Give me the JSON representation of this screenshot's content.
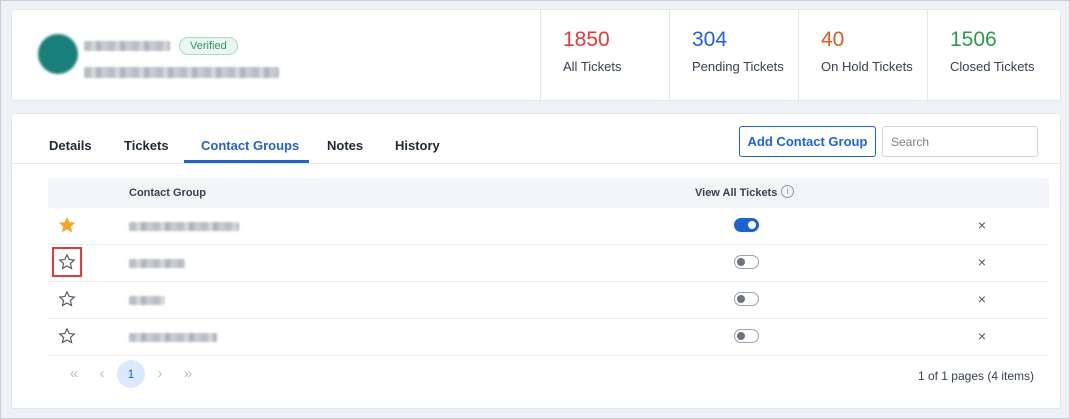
{
  "contact": {
    "verified_label": "Verified"
  },
  "stats": [
    {
      "value": "1850",
      "label": "All Tickets",
      "color": "#e53935"
    },
    {
      "value": "304",
      "label": "Pending Tickets",
      "color": "#1e63d6"
    },
    {
      "value": "40",
      "label": "On Hold Tickets",
      "color": "#e8571e"
    },
    {
      "value": "1506",
      "label": "Closed Tickets",
      "color": "#2e9a4a"
    }
  ],
  "tabs": [
    "Details",
    "Tickets",
    "Contact Groups",
    "Notes",
    "History"
  ],
  "active_tab": "Contact Groups",
  "toolbar": {
    "add_label": "Add Contact Group",
    "search_placeholder": "Search"
  },
  "table": {
    "headers": {
      "group": "Contact Group",
      "view_all": "View All Tickets"
    },
    "rows": [
      {
        "starred": true,
        "view_all": true
      },
      {
        "starred": false,
        "view_all": false
      },
      {
        "starred": false,
        "view_all": false
      },
      {
        "starred": false,
        "view_all": false
      }
    ]
  },
  "pagination": {
    "current_page": "1",
    "info": "1 of 1 pages (4 items)"
  },
  "icons": {
    "first": "«",
    "prev": "‹",
    "next": "›",
    "last": "»",
    "close": "×",
    "info": "i"
  },
  "colors": {
    "accent": "#1e63d6",
    "star_filled": "#f5a623",
    "verified": "#2e9a6a"
  }
}
